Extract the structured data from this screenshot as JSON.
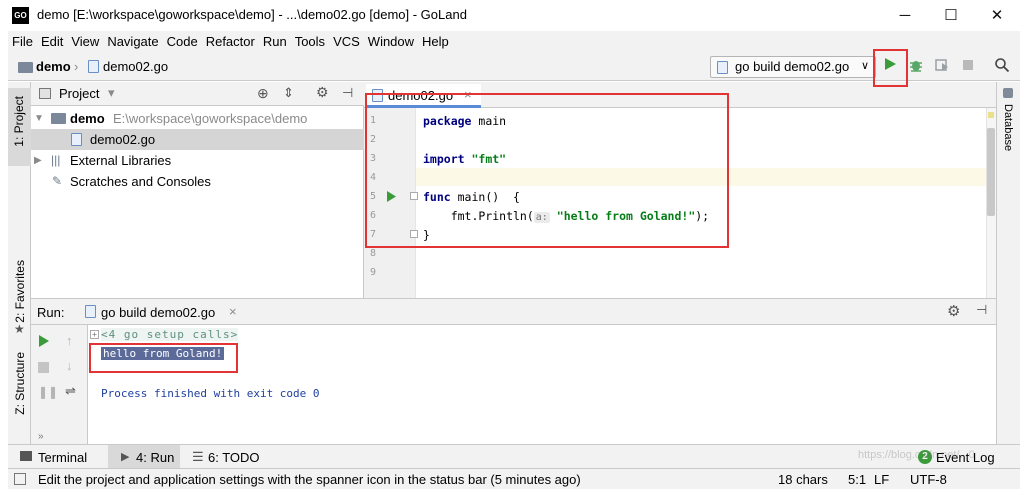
{
  "window": {
    "title": "demo [E:\\workspace\\goworkspace\\demo] - ...\\demo02.go [demo] - GoLand",
    "logo_text": "GO",
    "minimize": "─",
    "maximize": "☐",
    "close": "✕"
  },
  "menu": [
    "File",
    "Edit",
    "View",
    "Navigate",
    "Code",
    "Refactor",
    "Run",
    "Tools",
    "VCS",
    "Window",
    "Help"
  ],
  "breadcrumb": {
    "project": "demo",
    "separator": "›",
    "file": "demo02.go"
  },
  "toolbar": {
    "run_config": "go build demo02.go",
    "dropdown": "∨"
  },
  "left_strip": {
    "project": "1: Project",
    "favorites": "2: Favorites",
    "structure": "Z: Structure"
  },
  "right_strip": {
    "database": "Database"
  },
  "project_panel": {
    "title": "Project",
    "dropdown": "▾",
    "tree": [
      {
        "name": "demo",
        "path": "E:\\workspace\\goworkspace\\demo"
      },
      {
        "name": "demo02.go"
      },
      {
        "name": "External Libraries"
      },
      {
        "name": "Scratches and Consoles"
      }
    ]
  },
  "editor": {
    "tab_label": "demo02.go",
    "tab_close": "×",
    "line_numbers": [
      "1",
      "2",
      "3",
      "4",
      "5",
      "6",
      "7",
      "8",
      "9"
    ],
    "code": {
      "l1_kw": "package",
      "l1_rest": " main",
      "l3_kw": "import",
      "l3_str": "\"fmt\"",
      "l5_kw": "func",
      "l5_rest": " main()  {",
      "l6_pre": "    fmt.Println(",
      "l6_hint": "a:",
      "l6_str": "\"hello from Goland!\"",
      "l6_post": ");",
      "l7": "}"
    }
  },
  "run_panel": {
    "label": "Run:",
    "tab_label": "go build demo02.go",
    "tab_close": "×",
    "console": {
      "setup": "<4 go setup calls>",
      "output": "hello from Goland!",
      "finished": "Process finished with exit code 0"
    }
  },
  "bottom_tabs": {
    "terminal": "Terminal",
    "run": "4: Run",
    "todo": "6: TODO",
    "event_log": "Event Log",
    "event_count": "2"
  },
  "status": {
    "message": "Edit the project and application settings with the spanner icon in the status bar (5 minutes ago)",
    "chars": "18 chars",
    "position": "5:1",
    "line_sep": "LF",
    "encoding": "UTF-8",
    "watermark": "https://blog.csdn.net/...0"
  },
  "colors": {
    "highlight_red": "#e23434",
    "run_green": "#3a9b3a",
    "selection": "#214283"
  }
}
